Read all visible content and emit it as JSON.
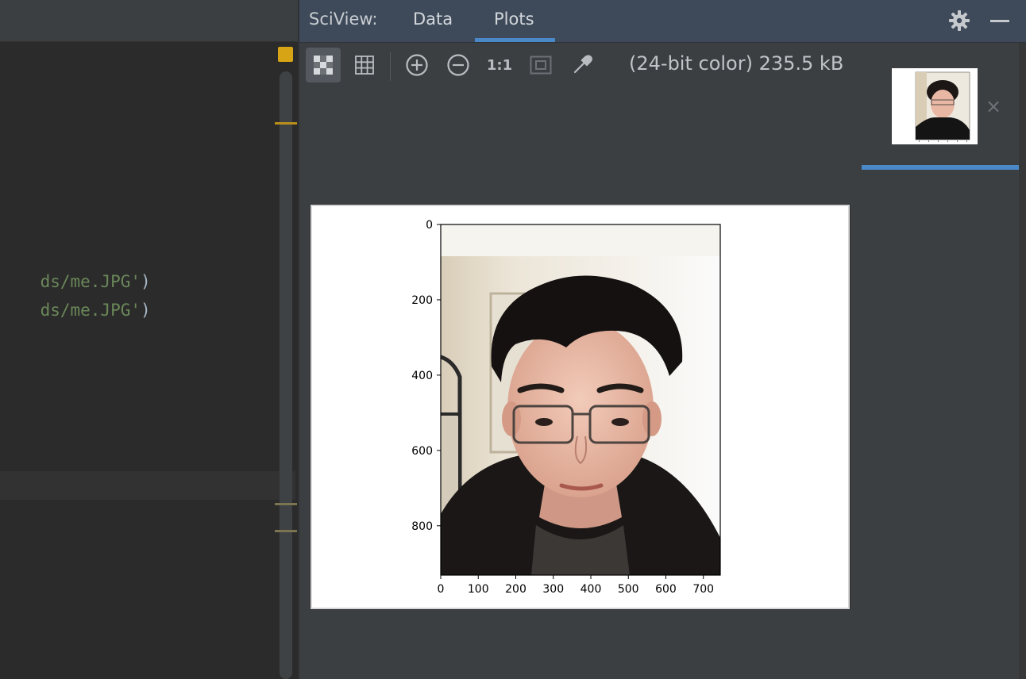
{
  "editor": {
    "code_lines": [
      {
        "string": "ds/me.JPG'",
        "close": ")"
      },
      {
        "string": "ds/me.JPG'",
        "close": ")"
      }
    ]
  },
  "sciview": {
    "title": "SciView:",
    "tabs": [
      {
        "label": "Data",
        "active": false
      },
      {
        "label": "Plots",
        "active": true
      }
    ],
    "header_icons": [
      "gear-icon",
      "minimize-icon"
    ],
    "toolbar": {
      "buttons": [
        {
          "name": "transparency-checker",
          "icon": "checkerboard-icon",
          "active": true
        },
        {
          "name": "grid",
          "icon": "grid-icon",
          "active": false
        },
        {
          "name": "zoom-in",
          "icon": "zoom-in-icon",
          "active": false
        },
        {
          "name": "zoom-out",
          "icon": "zoom-out-icon",
          "active": false
        },
        {
          "name": "actual-size",
          "label": "1:1",
          "active": false
        },
        {
          "name": "fit-to-window",
          "icon": "fit-window-icon",
          "active": false
        },
        {
          "name": "color-picker",
          "icon": "eyedropper-icon",
          "active": false
        }
      ],
      "image_info": "(24-bit color) 235.5 kB"
    },
    "thumbnail": {
      "close_glyph": "×"
    },
    "accent_color": "#4a88c7"
  },
  "chart_data": {
    "type": "image",
    "title": "",
    "xlabel": "",
    "ylabel": "",
    "xlim": [
      0,
      745
    ],
    "ylim": [
      931,
      0
    ],
    "xticks": [
      0,
      100,
      200,
      300,
      400,
      500,
      600,
      700
    ],
    "yticks": [
      0,
      200,
      400,
      600,
      800
    ],
    "content": "photo"
  }
}
